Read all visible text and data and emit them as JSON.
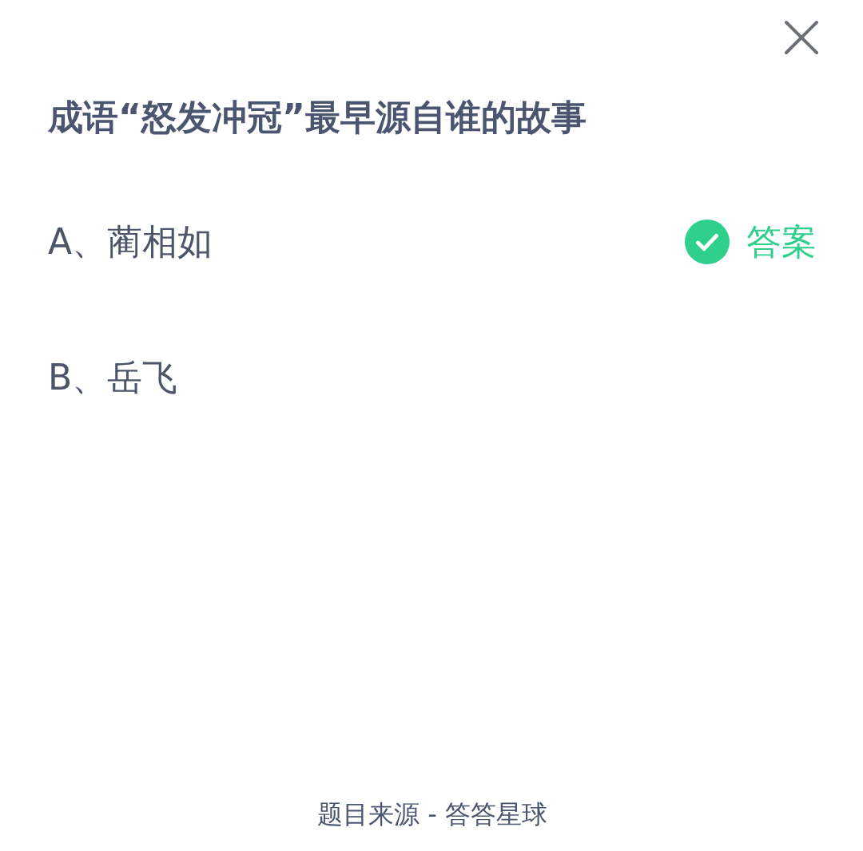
{
  "question": "成语“怒发冲冠”最早源自谁的故事",
  "options": [
    {
      "label": "A、蔺相如",
      "correct": true
    },
    {
      "label": "B、岳飞",
      "correct": false
    }
  ],
  "answer_label": "答案",
  "footer": "题目来源 - 答答星球"
}
